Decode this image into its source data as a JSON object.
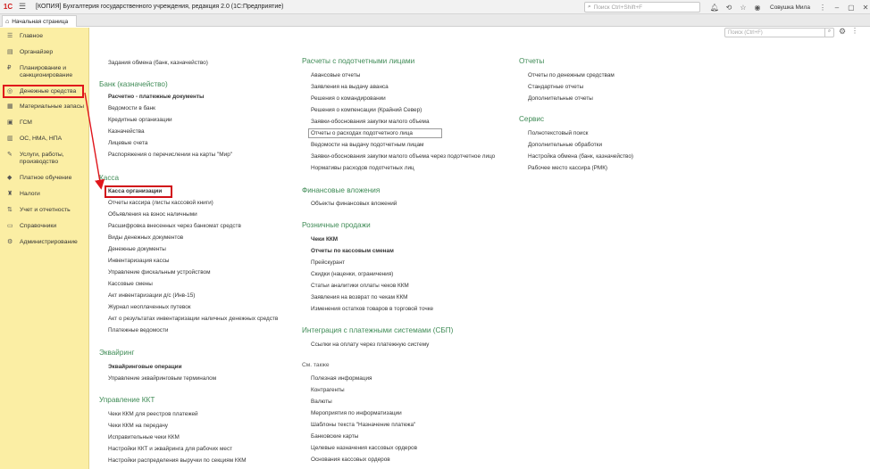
{
  "titlebar": {
    "logo": "1С",
    "title": "[КОПИЯ] Бухгалтерия государственного учреждения, редакция 2.0 (1С:Предприятие)",
    "search_placeholder": "Поиск Ctrl+Shift+F",
    "user_name": "Совушка Мила",
    "icons": [
      "bell-icon",
      "history-icon",
      "star-icon",
      "user-icon",
      "more-icon"
    ]
  },
  "tabs": {
    "home_label": "Начальная страница"
  },
  "sidebar": {
    "items": [
      {
        "label": "Главное",
        "icon": "menu-icon"
      },
      {
        "label": "Органайзер",
        "icon": "organizer-icon"
      },
      {
        "label": "Планирование и санкционирование",
        "icon": "planning-icon"
      },
      {
        "label": "Денежные средства",
        "icon": "money-icon"
      },
      {
        "label": "Материальные запасы",
        "icon": "stock-icon"
      },
      {
        "label": "ГСМ",
        "icon": "fuel-icon"
      },
      {
        "label": "ОС, НМА, НПА",
        "icon": "assets-icon"
      },
      {
        "label": "Услуги, работы, производство",
        "icon": "services-icon"
      },
      {
        "label": "Платное обучение",
        "icon": "education-icon"
      },
      {
        "label": "Налоги",
        "icon": "taxes-icon"
      },
      {
        "label": "Учет и отчетность",
        "icon": "reports-icon"
      },
      {
        "label": "Справочники",
        "icon": "catalogs-icon"
      },
      {
        "label": "Администрирование",
        "icon": "admin-icon"
      }
    ]
  },
  "content": {
    "search_placeholder": "Поиск (Ctrl+F)",
    "col1": {
      "top_item": "Задания обмена (банк, казначейство)",
      "bank": {
        "title": "Банк (казначейство)",
        "items": [
          "Расчетно - платежные документы",
          "Ведомости в банк",
          "Кредитные организации",
          "Казначейства",
          "Лицевые счета",
          "Распоряжения о перечислении на карты \"Мир\""
        ]
      },
      "cash": {
        "title": "Касса",
        "items": [
          "Касса организации",
          "Отчеты кассира (листы кассовой книги)",
          "Объявления на взнос наличными",
          "Расшифровка внесенных через банкомат средств",
          "Виды денежных документов",
          "Денежные документы",
          "Инвентаризация кассы",
          "Управление фискальным устройством",
          "Кассовые смены",
          "Акт инвентаризации д/с (Инв-15)",
          "Журнал неоплаченных путевок",
          "Акт о результатах инвентаризации наличных денежных средств",
          "Платежные ведомости"
        ]
      },
      "acquiring": {
        "title": "Эквайринг",
        "items": [
          "Эквайринговые операции",
          "Управление эквайринговым терминалом"
        ]
      },
      "kkt": {
        "title": "Управление ККТ",
        "items": [
          "Чеки ККМ для реестров платежей",
          "Чеки ККМ на передачу",
          "Исправительные чеки ККМ",
          "Настройки ККТ и эквайринга для рабочих мест",
          "Настройки распределения выручки по секциям ККМ"
        ]
      }
    },
    "col2": {
      "accountable": {
        "title": "Расчеты с подотчетными лицами",
        "items": [
          "Авансовые отчеты",
          "Заявления на выдачу аванса",
          "Решения о командировании",
          "Решения о компенсации (Крайний Север)",
          "Заявки-обоснования закупки малого объема",
          "Отчеты о расходах подотчетного лица",
          "Ведомости на выдачу подотчетным лицам",
          "Заявки-обоснования закупки малого объема через подотчетное лицо",
          "Нормативы расходов подотчетных лиц"
        ]
      },
      "finance": {
        "title": "Финансовые вложения",
        "items": [
          "Объекты финансовых вложений"
        ]
      },
      "retail": {
        "title": "Розничные продажи",
        "items": [
          "Чеки ККМ",
          "Отчеты по кассовым сменам",
          "Прейскурант",
          "Скидки (наценки, ограничения)",
          "Статьи аналитики оплаты чеков ККМ",
          "Заявления на возврат по чекам ККМ",
          "Изменения остатков товаров в торговой точке"
        ]
      },
      "sbp": {
        "title": "Интеграция с платежными системами (СБП)",
        "items": [
          "Ссылки на оплату через платежную систему"
        ]
      },
      "see_also": {
        "title": "См. также",
        "items": [
          "Полезная информация",
          "Контрагенты",
          "Валюты",
          "Мероприятия по информатизации",
          "Шаблоны текста \"Назначение платежа\"",
          "Банковские карты",
          "Целевые назначения кассовых ордеров",
          "Основания кассовых ордеров"
        ]
      }
    },
    "col3": {
      "reports": {
        "title": "Отчеты",
        "items": [
          "Отчеты по денежным средствам",
          "Стандартные отчеты",
          "Дополнительные отчеты"
        ]
      },
      "service": {
        "title": "Сервис",
        "items": [
          "Полнотекстовый поиск",
          "Дополнительные обработки",
          "Настройка обмена (банк, казначейство)",
          "Рабочее место кассира (РМК)"
        ]
      }
    }
  },
  "colors": {
    "sidebar_bg": "#fbeea4",
    "section_title": "#3f8b56",
    "highlight": "#e0151b"
  }
}
